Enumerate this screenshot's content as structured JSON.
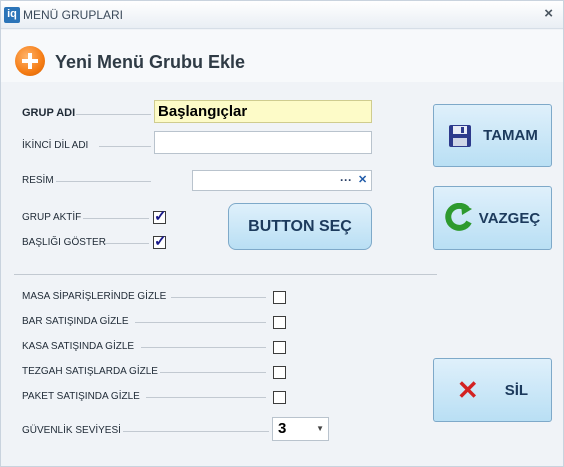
{
  "window": {
    "title": "MENÜ GRUPLARI",
    "app_icon_text": "iq"
  },
  "heading": "Yeni Menü Grubu Ekle",
  "form": {
    "group_name_label": "GRUP ADI",
    "group_name_value": "Başlangıçlar",
    "second_lang_label": "İKİNCİ DİL ADI",
    "second_lang_value": "",
    "image_label": "RESİM",
    "image_value": "",
    "image_browse": "···",
    "image_clear": "✕",
    "group_active_label": "GRUP AKTİF",
    "group_active_checked": true,
    "show_title_label": "BAŞLIĞI GÖSTER",
    "show_title_checked": true,
    "button_select_label": "BUTTON SEÇ"
  },
  "hide_options": [
    {
      "label": "MASA SİPARİŞLERİNDE GİZLE",
      "checked": false
    },
    {
      "label": "BAR SATIŞINDA GİZLE",
      "checked": false
    },
    {
      "label": "KASA SATIŞINDA GİZLE",
      "checked": false
    },
    {
      "label": "TEZGAH SATIŞLARDA GİZLE",
      "checked": false
    },
    {
      "label": "PAKET SATIŞINDA GİZLE",
      "checked": false
    }
  ],
  "security": {
    "label": "GÜVENLİK SEVİYESİ",
    "value": "3"
  },
  "buttons": {
    "ok": "TAMAM",
    "cancel": "VAZGEÇ",
    "delete": "SİL"
  }
}
